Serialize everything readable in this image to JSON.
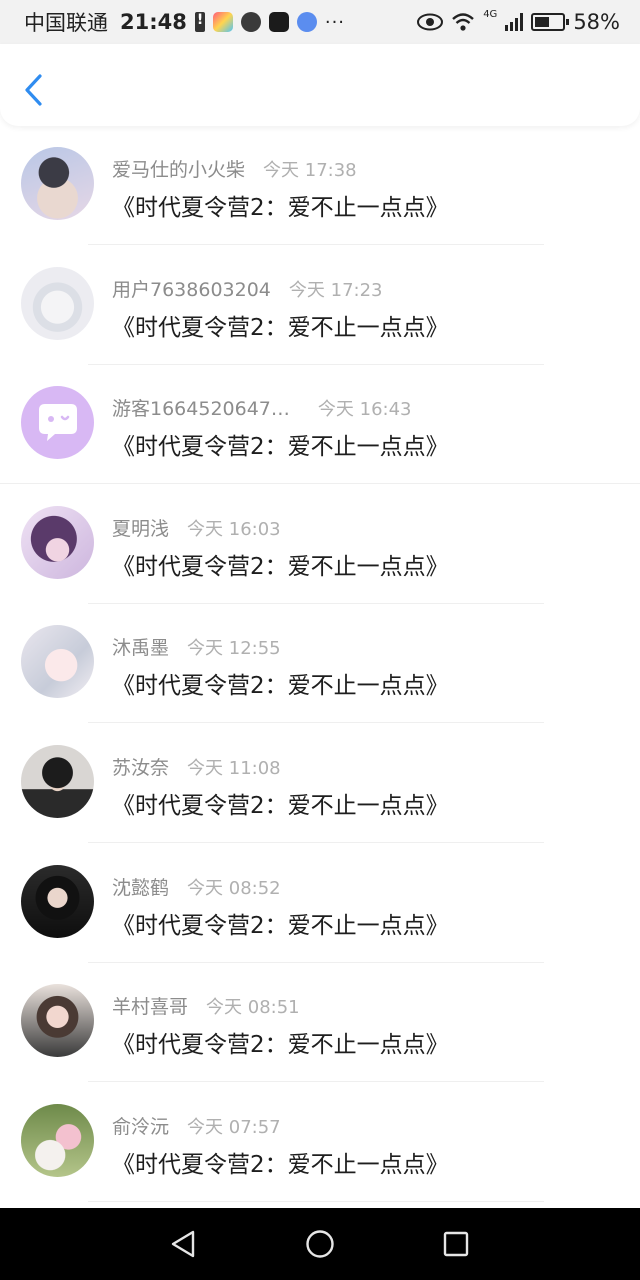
{
  "statusbar": {
    "carrier": "中国联通",
    "time": "21:48",
    "dots": "···",
    "network": "4G",
    "battery": "58%"
  },
  "header": {
    "back_icon": "chevron-left-icon"
  },
  "list": [
    {
      "name": "爱马仕的小火柴",
      "time": "今天 17:38",
      "msg": "《时代夏令营2：爱不止一点点》"
    },
    {
      "name": "用户7638603204",
      "time": "今天 17:23",
      "msg": "《时代夏令营2：爱不止一点点》"
    },
    {
      "name": "游客1664520647…",
      "time": "今天 16:43",
      "msg": "《时代夏令营2：爱不止一点点》"
    },
    {
      "name": "夏明浅",
      "time": "今天 16:03",
      "msg": "《时代夏令营2：爱不止一点点》"
    },
    {
      "name": "沐禹墨",
      "time": "今天 12:55",
      "msg": "《时代夏令营2：爱不止一点点》"
    },
    {
      "name": "苏汝奈",
      "time": "今天 11:08",
      "msg": "《时代夏令营2：爱不止一点点》"
    },
    {
      "name": "沈懿鹤",
      "time": "今天 08:52",
      "msg": "《时代夏令营2：爱不止一点点》"
    },
    {
      "name": "羊村喜哥",
      "time": "今天 08:51",
      "msg": "《时代夏令营2：爱不止一点点》"
    },
    {
      "name": "俞泠沅",
      "time": "今天 07:57",
      "msg": "《时代夏令营2：爱不止一点点》"
    }
  ],
  "colors": {
    "accent": "#2f8cf0",
    "guest_avatar": "#d8b8f4"
  }
}
